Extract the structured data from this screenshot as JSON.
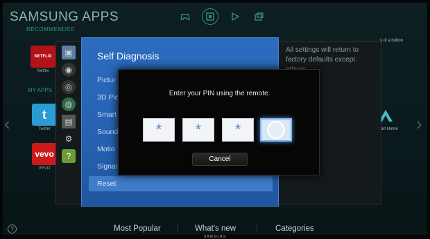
{
  "header": {
    "title": "SAMSUNG APPS",
    "subtitle": "RECOMMENDED",
    "icons": [
      "gamepad-icon",
      "apps-icon",
      "play-icon",
      "multiscreen-icon"
    ]
  },
  "sections": {
    "my_apps": "MY APPS"
  },
  "apps": [
    {
      "name": "Netflix",
      "logo": "NETFLIX",
      "color": "#b3121b"
    },
    {
      "name": "Twitter",
      "logo": "t",
      "color": "#2b9bd6"
    },
    {
      "name": "VEVO",
      "logo": "vevo",
      "color": "#cc1a1a"
    }
  ],
  "right_tiles": {
    "top_caption": "s of a button",
    "bottom_caption": "Smart Home"
  },
  "settings_panel": {
    "note": "All settings will return to factory defaults except ettings.",
    "icons": [
      "picture-icon",
      "sound-icon",
      "network-icon",
      "globe-icon",
      "system-icon",
      "support-icon",
      "help-icon"
    ]
  },
  "self_diagnosis": {
    "title": "Self Diagnosis",
    "items": [
      "Pictur",
      "3D Pic",
      "Smart",
      "Sound",
      "Motio",
      "Signal",
      "Reset"
    ],
    "selected_index": 6
  },
  "pin_dialog": {
    "prompt": "Enter your PIN using the remote.",
    "digits": [
      "*",
      "*",
      "*",
      ""
    ],
    "active_index": 3,
    "cancel_label": "Cancel"
  },
  "bottom_bar": {
    "help": "?",
    "items": [
      "Most Popular",
      "What's new",
      "Categories"
    ]
  },
  "bezel": {
    "brand": "SAMSUNG"
  },
  "colors": {
    "diag_blue": "#2661b0",
    "accent_teal": "#2f8f8a",
    "pin_highlight": "#7eb2ec"
  }
}
